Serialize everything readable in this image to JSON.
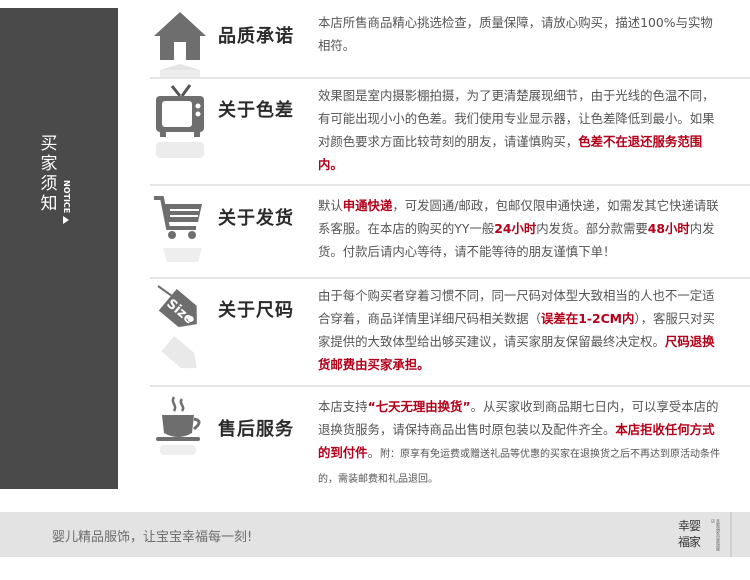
{
  "sidebar": {
    "title": "买家须知",
    "notice": "NOTICE"
  },
  "rows": [
    {
      "icon": "house-icon",
      "title": "品质承诺",
      "text_parts": [
        "本店所售商品精心挑选检查，质量保障，请放心购买，描述100%与实物相符。"
      ]
    },
    {
      "icon": "tv-icon",
      "title": "关于色差",
      "text_parts": [
        "效果图是室内摄影棚拍摄，为了更清楚展现细节，由于光线的色温不同，有可能出现小小的色差。我们使用专业显示器，让色差降低到最小。如果对颜色要求方面比较苛刻的朋友，请谨慎购买，",
        "色差不在退还服务范围内。"
      ]
    },
    {
      "icon": "cart-icon",
      "title": "关于发货",
      "text_parts": [
        "默认",
        "申通快递",
        "，可发圆通/邮政，包邮仅限申通快递，如需发其它快递请联系客服。在本店的购买的YY一般",
        "24小时",
        "内发货。部分款需要",
        "48小时",
        "内发货。付款后请内心等待，请不能等待的朋友谨慎下单！"
      ]
    },
    {
      "icon": "size-tag-icon",
      "icon_label": "Size",
      "title": "关于尺码",
      "text_parts": [
        "由于每个购买者穿着习惯不同，同一尺码对体型大致相当的人也不一定适合穿着，商品详情里详细尺码相关数据（",
        "误差在1-2CM内",
        "），客服只对买家提供的大致体型给出够买建议，请买家朋友保留最终决定权。",
        "尺码退换货邮费由买家承担。"
      ]
    },
    {
      "icon": "coffee-cup-icon",
      "title": "售后服务",
      "text_parts": [
        "本店支持",
        "“七天无理由换货”",
        "。从买家收到商品期七日内，可以享受本店的退换货服务，请保持商品出售时原包装以及配件齐全。",
        "本店拒收任何方式的到付件",
        "。",
        "附：原享有免运费或赠送礼品等优惠的买家在退换货之后不再达到原活动条件的，需装邮费和礼品退回。"
      ]
    }
  ],
  "footer": {
    "slogan": "婴儿精品服饰，让宝宝幸福每一刻!",
    "logo_text": "幸婴福家",
    "logo_sub": "幸婴福家母婴旗舰店"
  },
  "colors": {
    "sidebar": "#4a4a4a",
    "accent_red": "#b3001b",
    "footer": "#e3e3e3"
  }
}
